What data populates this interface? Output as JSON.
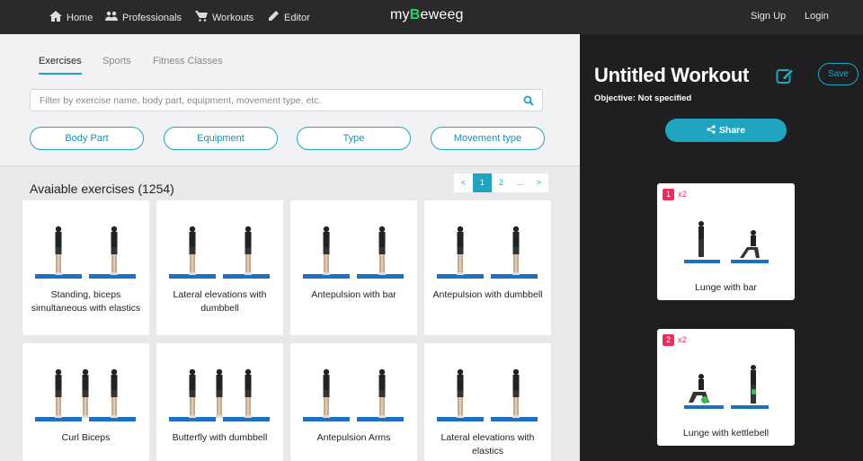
{
  "nav": {
    "home": "Home",
    "professionals": "Professionals",
    "workouts": "Workouts",
    "editor": "Editor",
    "logo_pre": "my",
    "logo_b": "B",
    "logo_post": "eweeg",
    "signup": "Sign Up",
    "login": "Login"
  },
  "tabs": [
    "Exercises",
    "Sports",
    "Fitness Classes"
  ],
  "search": {
    "placeholder": "Filter by exercise name, body part, equipment, movement type, etc."
  },
  "filters": [
    "Body Part",
    "Equipment",
    "Type",
    "Movement type"
  ],
  "available_title": "Avaiable exercises (1254)",
  "pagination": [
    "<",
    "1",
    "2",
    "...",
    ">"
  ],
  "exercises": [
    "Standing, biceps simultaneous with elastics",
    "Lateral elevations with dumbbell",
    "Antepulsion with bar",
    "Antepulsion with dumbbell",
    "Curl Biceps",
    "Butterfly with dumbbell",
    "Antepulsion Arms",
    "Lateral elevations with elastics"
  ],
  "workout": {
    "title": "Untitled Workout",
    "save_label": "Save",
    "objective_label": "Objective:",
    "objective_value": "Not specified",
    "share_label": "Share",
    "items": [
      {
        "index": "1",
        "reps": "x2",
        "name": "Lunge with bar"
      },
      {
        "index": "2",
        "reps": "x2",
        "name": "Lunge with kettlebell"
      }
    ]
  },
  "colors": {
    "accent": "#1fa5c0",
    "badge": "#e8305f",
    "nav_bg": "#2a2a2d",
    "panel_bg": "#1f1f22",
    "mat": "#1f6fc2"
  }
}
